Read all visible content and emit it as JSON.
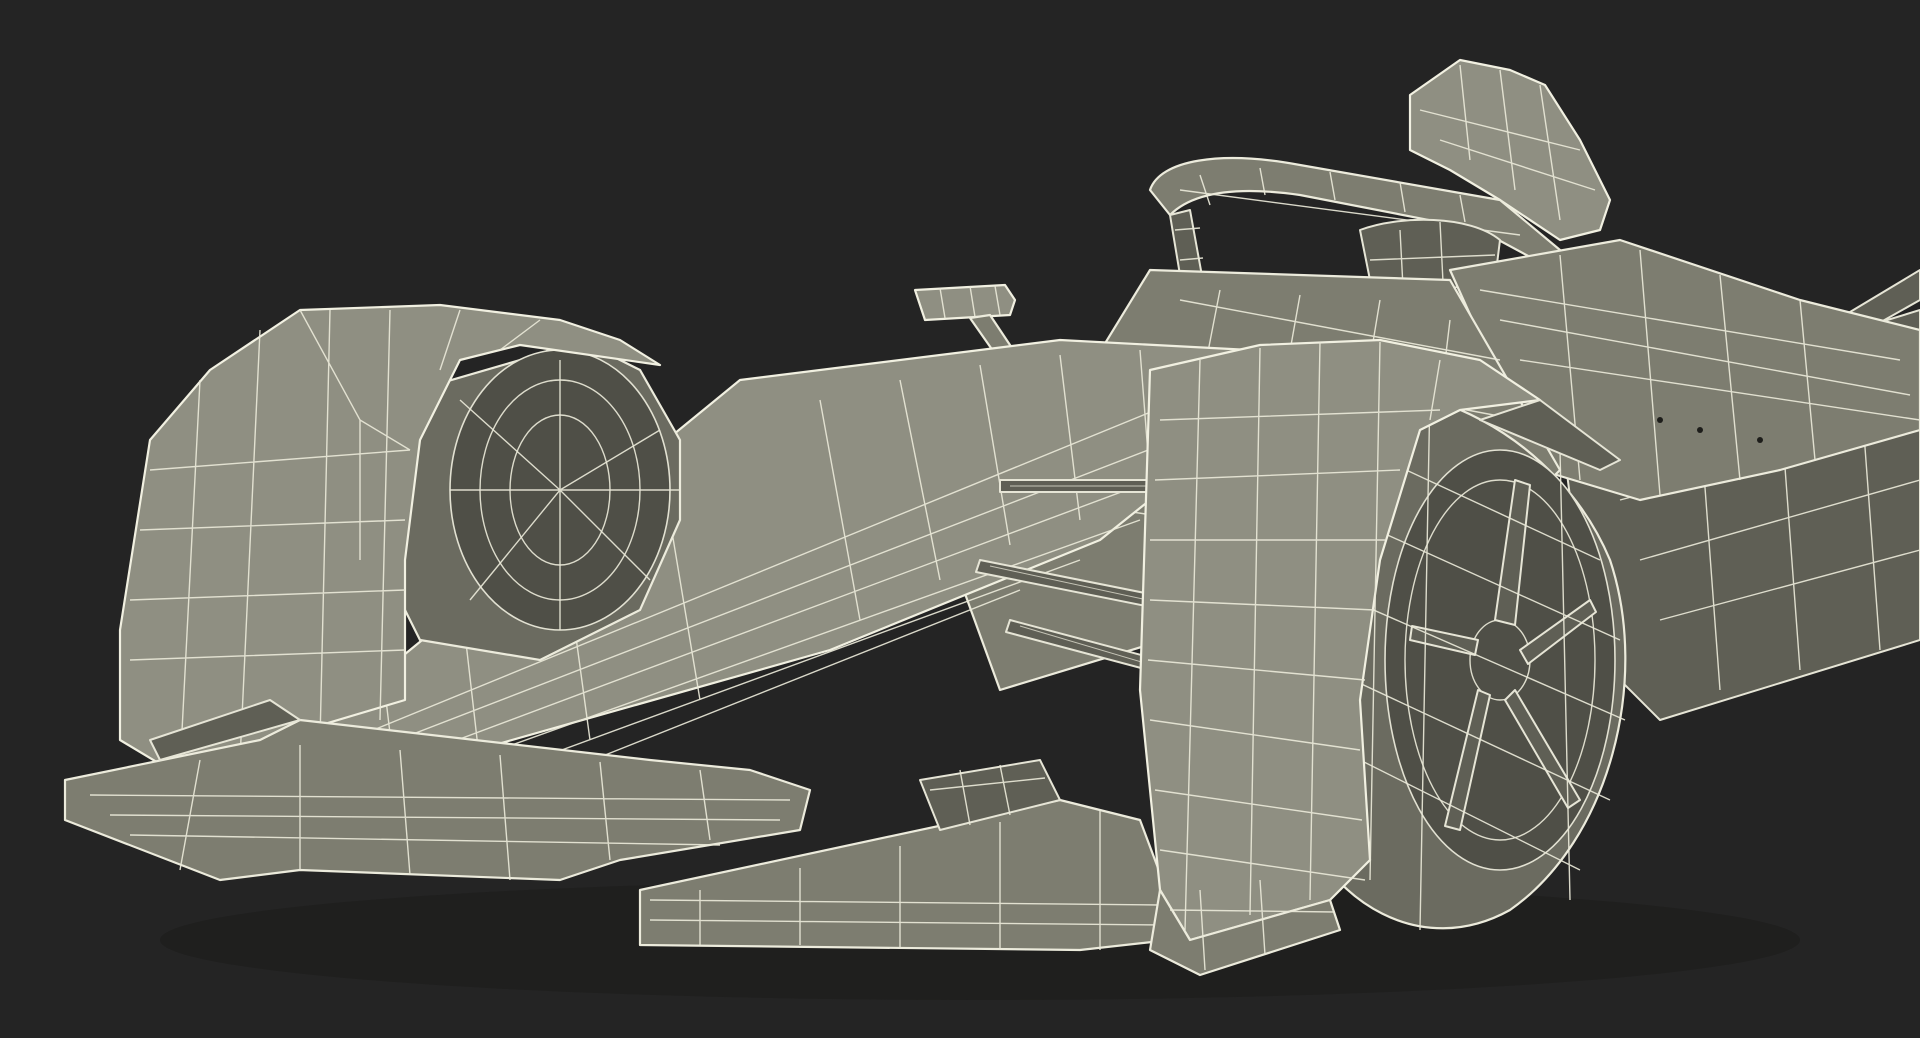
{
  "scene": {
    "subject": "formula-e-race-car-wireframe",
    "background_color": "#242424",
    "mesh_fill_color": "#7d7d70",
    "wire_color": "#ecebdc"
  }
}
